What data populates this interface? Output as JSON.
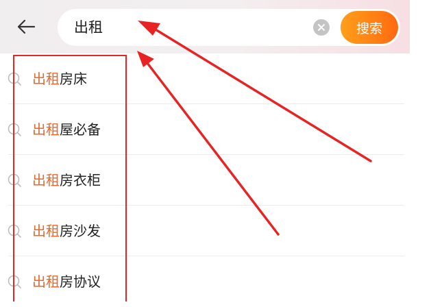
{
  "search": {
    "value": "出租",
    "button_label": "搜索"
  },
  "suggestions": [
    {
      "highlight": "出租",
      "rest": "房床"
    },
    {
      "highlight": "出租",
      "rest": "屋必备"
    },
    {
      "highlight": "出租",
      "rest": "房衣柜"
    },
    {
      "highlight": "出租",
      "rest": "房沙发"
    },
    {
      "highlight": "出租",
      "rest": "房协议"
    }
  ],
  "colors": {
    "accent": "#ff7a14",
    "highlight": "#e8682a",
    "annotation": "#e82323"
  },
  "icons": {
    "back": "arrow-left-icon",
    "clear": "close-circle-icon",
    "suggestion": "search-icon"
  }
}
